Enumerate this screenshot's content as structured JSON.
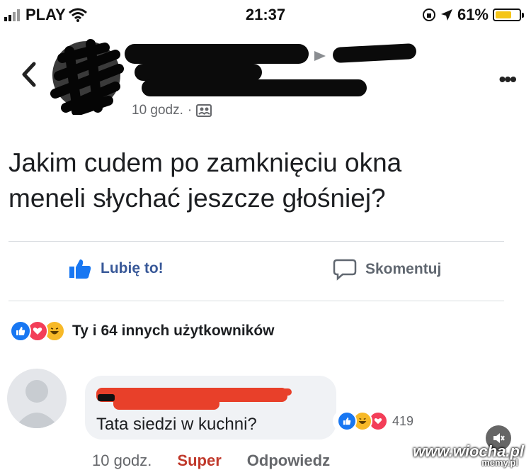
{
  "status_bar": {
    "carrier": "PLAY",
    "time": "21:37",
    "battery": "61%",
    "battery_level": 0.61
  },
  "post": {
    "timestamp": "10 godz.",
    "separator": "·",
    "text_line1": "Jakim cudem po zamknięciu okna",
    "text_line2": "meneli słychać jeszcze głośniej?"
  },
  "actions": {
    "like_label": "Lubię to!",
    "comment_label": "Skomentuj"
  },
  "reactions_summary": "Ty i 64 innych użytkowników",
  "comment": {
    "text": "Tata siedzi w kuchni?",
    "reaction_count": "419",
    "time": "10 godz.",
    "react_label": "Super",
    "reply_label": "Odpowiedz"
  },
  "watermark": {
    "main": "www.wiocha.pl",
    "sub": "memy.pl"
  },
  "colors": {
    "like_blue": "#1877f2",
    "love_red": "#f33e58",
    "haha_yellow": "#f7b928",
    "redaction_black": "#0b0b0b",
    "redaction_red": "#e8402a"
  }
}
